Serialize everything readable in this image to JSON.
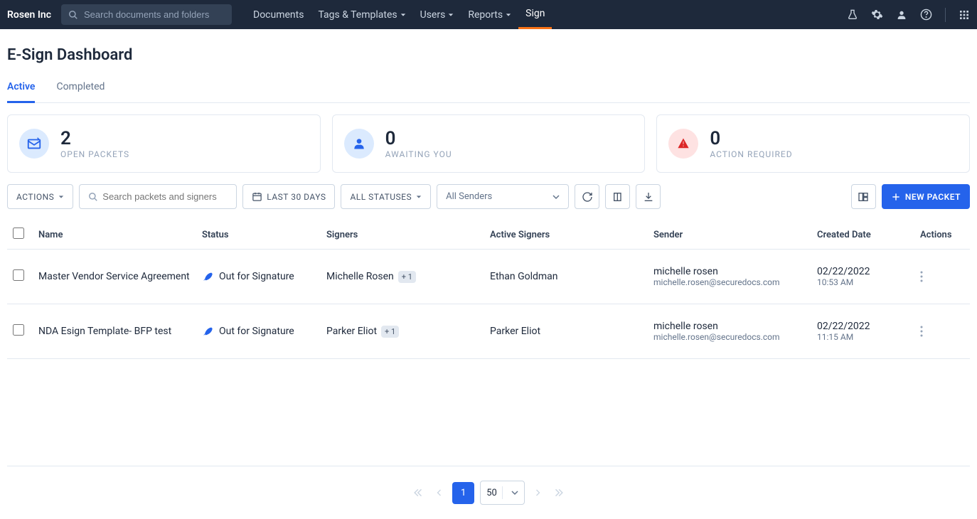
{
  "brand": "Rosen Inc",
  "search_placeholder": "Search documents and folders",
  "nav": {
    "documents": "Documents",
    "tags": "Tags & Templates",
    "users": "Users",
    "reports": "Reports",
    "sign": "Sign"
  },
  "page_title": "E-Sign Dashboard",
  "tabs": {
    "active": "Active",
    "completed": "Completed"
  },
  "cards": {
    "open": {
      "count": "2",
      "label": "OPEN PACKETS"
    },
    "awaiting": {
      "count": "0",
      "label": "AWAITING YOU"
    },
    "action": {
      "count": "0",
      "label": "ACTION REQUIRED"
    }
  },
  "toolbar": {
    "actions": "ACTIONS",
    "search_placeholder": "Search packets and signers",
    "date_filter": "LAST 30 DAYS",
    "status_filter": "ALL STATUSES",
    "sender_filter": "All Senders",
    "new_packet": "NEW PACKET"
  },
  "columns": {
    "name": "Name",
    "status": "Status",
    "signers": "Signers",
    "active_signers": "Active Signers",
    "sender": "Sender",
    "created": "Created Date",
    "actions": "Actions"
  },
  "rows": [
    {
      "name": "Master Vendor Service Agreement",
      "status": "Out for Signature",
      "signer": "Michelle Rosen",
      "signer_badge": "+ 1",
      "active_signer": "Ethan Goldman",
      "sender_name": "michelle rosen",
      "sender_email": "michelle.rosen@securedocs.com",
      "date": "02/22/2022",
      "time": "10:53 AM"
    },
    {
      "name": "NDA Esign Template- BFP test",
      "status": "Out for Signature",
      "signer": "Parker Eliot",
      "signer_badge": "+ 1",
      "active_signer": "Parker Eliot",
      "sender_name": "michelle rosen",
      "sender_email": "michelle.rosen@securedocs.com",
      "date": "02/22/2022",
      "time": "11:15 AM"
    }
  ],
  "pager": {
    "page": "1",
    "size": "50"
  }
}
